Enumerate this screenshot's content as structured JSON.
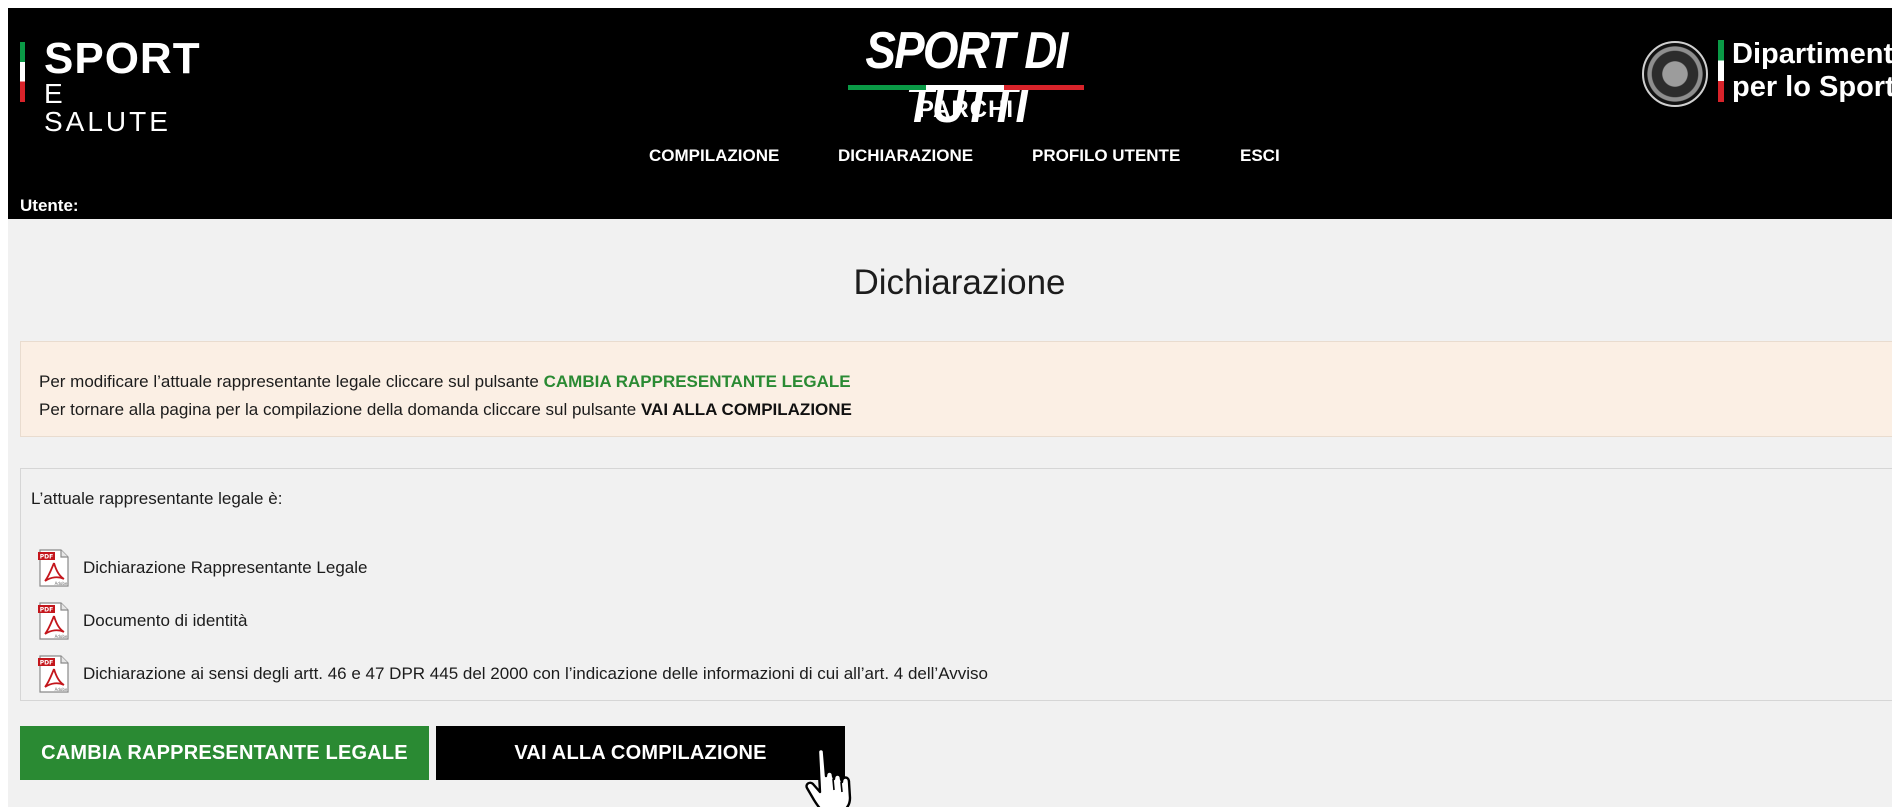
{
  "header": {
    "brand_left": {
      "line1": "SPORT",
      "line2": "E SALUTE"
    },
    "brand_center": {
      "title": "SPORT DI TUTTI",
      "subtitle": "PARCHI"
    },
    "brand_right": {
      "line1": "Dipartimento",
      "line2": "per lo Sport"
    },
    "nav": [
      {
        "label": "COMPILAZIONE"
      },
      {
        "label": "DICHIARAZIONE"
      },
      {
        "label": "PROFILO UTENTE"
      },
      {
        "label": "ESCI"
      }
    ],
    "user_label": "Utente:"
  },
  "main": {
    "title": "Dichiarazione",
    "alert": {
      "line1_prefix": "Per modificare l’attuale rappresentante legale cliccare sul pulsante ",
      "line1_highlight": "CAMBIA RAPPRESENTANTE LEGALE",
      "line2_prefix": "Per tornare alla pagina per la compilazione della domanda cliccare sul pulsante ",
      "line2_highlight": "VAI ALLA COMPILAZIONE"
    },
    "docs_intro": "L’attuale rappresentante legale è:",
    "documents": [
      {
        "label": "Dichiarazione Rappresentante Legale",
        "icon": "pdf-icon"
      },
      {
        "label": "Documento di identità",
        "icon": "pdf-icon"
      },
      {
        "label": "Dichiarazione ai sensi degli artt. 46 e 47 DPR 445 del 2000 con l’indicazione delle informazioni di cui all’art. 4 dell’Avviso",
        "icon": "pdf-icon"
      }
    ],
    "buttons": {
      "change_rep": "CAMBIA RAPPRESENTANTE LEGALE",
      "go_compile": "VAI ALLA COMPILAZIONE"
    }
  },
  "colors": {
    "header_bg": "#000000",
    "accent_green": "#2a8a33",
    "alert_bg": "#fbefe4",
    "page_bg": "#f1f1f1"
  }
}
